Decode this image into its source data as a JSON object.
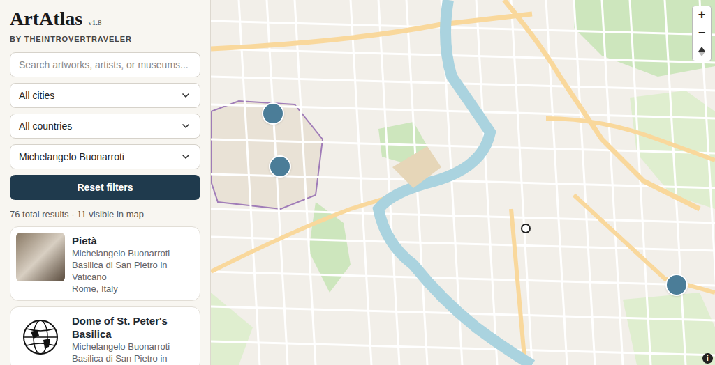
{
  "app": {
    "title": "ArtAtlas",
    "version": "v1.8",
    "byline": "BY THEINTROVERTRAVELER"
  },
  "search": {
    "placeholder": "Search artworks, artists, or museums..."
  },
  "filters": [
    {
      "label": "All cities"
    },
    {
      "label": "All countries"
    },
    {
      "label": "Michelangelo Buonarroti"
    }
  ],
  "reset_button": "Reset filters",
  "results_summary": "76 total results · 11 visible in map",
  "results": [
    {
      "title": "Pietà",
      "kind": "photo",
      "lines": [
        "Michelangelo Buonarroti",
        "Basilica di San Pietro in Vaticano",
        "Rome, Italy"
      ]
    },
    {
      "title": "Dome of St. Peter's Basilica",
      "kind": "logo",
      "lines": [
        "Michelangelo Buonarroti",
        "Basilica di San Pietro in"
      ]
    }
  ],
  "map": {
    "controls": [
      "+",
      "−"
    ],
    "info": "i",
    "markers": [
      {
        "kind": "cluster"
      },
      {
        "kind": "cluster"
      },
      {
        "kind": "point"
      },
      {
        "kind": "cluster"
      }
    ]
  }
}
